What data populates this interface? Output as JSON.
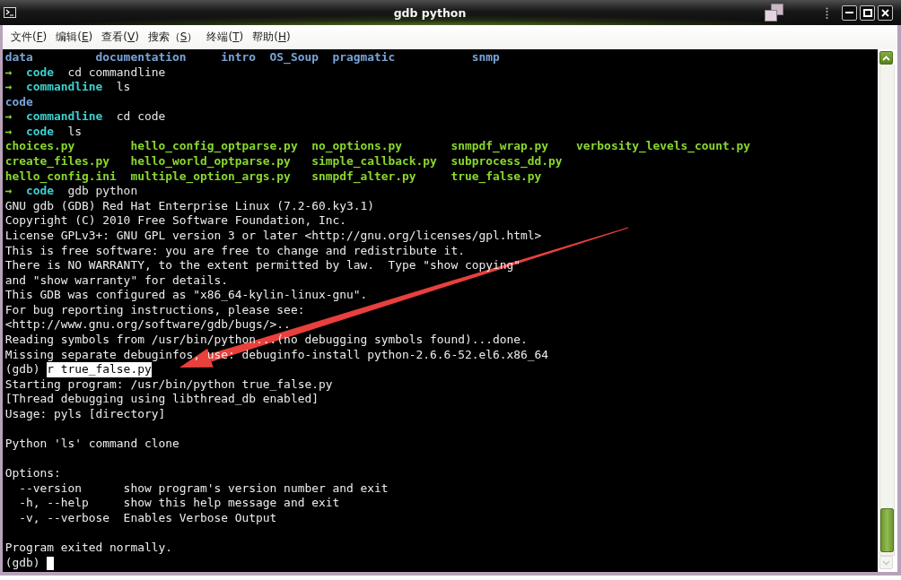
{
  "window": {
    "title": "gdb python"
  },
  "menu": [
    {
      "label": "文件",
      "mnemonic": "(F)"
    },
    {
      "label": "编辑",
      "mnemonic": "(E)"
    },
    {
      "label": "查看",
      "mnemonic": "(V)"
    },
    {
      "label": "搜索",
      "mnemonic": "（S）"
    },
    {
      "label": "终端",
      "mnemonic": "(T)"
    },
    {
      "label": "帮助",
      "mnemonic": "(H)"
    }
  ],
  "terminal": {
    "lines": [
      {
        "kind": "dirs",
        "text": "data         documentation     intro  OS_Soup  pragmatic           snmp"
      },
      {
        "kind": "prompt",
        "symbol": "→",
        "dir": "code",
        "command": "cd commandline"
      },
      {
        "kind": "prompt",
        "symbol": "→",
        "dir": "commandline",
        "command": "ls"
      },
      {
        "kind": "dirs",
        "text": "code"
      },
      {
        "kind": "prompt",
        "symbol": "→",
        "dir": "commandline",
        "command": "cd code"
      },
      {
        "kind": "prompt",
        "symbol": "→",
        "dir": "code",
        "command": "ls"
      },
      {
        "kind": "files",
        "text": "choices.py        hello_config_optparse.py  no_options.py       snmpdf_wrap.py    verbosity_levels_count.py"
      },
      {
        "kind": "files",
        "text": "create_files.py   hello_world_optparse.py   simple_callback.py  subprocess_dd.py"
      },
      {
        "kind": "files",
        "text": "hello_config.ini  multiple_option_args.py   snmpdf_alter.py     true_false.py"
      },
      {
        "kind": "prompt",
        "symbol": "→",
        "dir": "code",
        "command": "gdb python"
      },
      {
        "kind": "output",
        "text": "GNU gdb (GDB) Red Hat Enterprise Linux (7.2-60.ky3.1)"
      },
      {
        "kind": "output",
        "text": "Copyright (C) 2010 Free Software Foundation, Inc."
      },
      {
        "kind": "output",
        "text": "License GPLv3+: GNU GPL version 3 or later <http://gnu.org/licenses/gpl.html>"
      },
      {
        "kind": "output",
        "text": "This is free software: you are free to change and redistribute it."
      },
      {
        "kind": "output",
        "text": "There is NO WARRANTY, to the extent permitted by law.  Type \"show copying\""
      },
      {
        "kind": "output",
        "text": "and \"show warranty\" for details."
      },
      {
        "kind": "output",
        "text": "This GDB was configured as \"x86_64-kylin-linux-gnu\"."
      },
      {
        "kind": "output",
        "text": "For bug reporting instructions, please see:"
      },
      {
        "kind": "output",
        "text": "<http://www.gnu.org/software/gdb/bugs/>.."
      },
      {
        "kind": "output",
        "text": "Reading symbols from /usr/bin/python...(no debugging symbols found)...done."
      },
      {
        "kind": "output",
        "text": "Missing separate debuginfos, use: debuginfo-install python-2.6.6-52.el6.x86_64"
      },
      {
        "kind": "gdb",
        "prompt": "(gdb)",
        "input": "r true_false.py",
        "highlighted": true
      },
      {
        "kind": "output",
        "text": "Starting program: /usr/bin/python true_false.py"
      },
      {
        "kind": "output",
        "text": "[Thread debugging using libthread_db enabled]"
      },
      {
        "kind": "output",
        "text": "Usage: pyls [directory]"
      },
      {
        "kind": "blank"
      },
      {
        "kind": "output",
        "text": "Python 'ls' command clone"
      },
      {
        "kind": "blank"
      },
      {
        "kind": "output",
        "text": "Options:"
      },
      {
        "kind": "output",
        "text": "  --version      show program's version number and exit"
      },
      {
        "kind": "output",
        "text": "  -h, --help     show this help message and exit"
      },
      {
        "kind": "output",
        "text": "  -v, --verbose  Enables Verbose Output"
      },
      {
        "kind": "blank"
      },
      {
        "kind": "output",
        "text": "Program exited normally."
      },
      {
        "kind": "gdb",
        "prompt": "(gdb)",
        "cursor": true
      }
    ]
  }
}
